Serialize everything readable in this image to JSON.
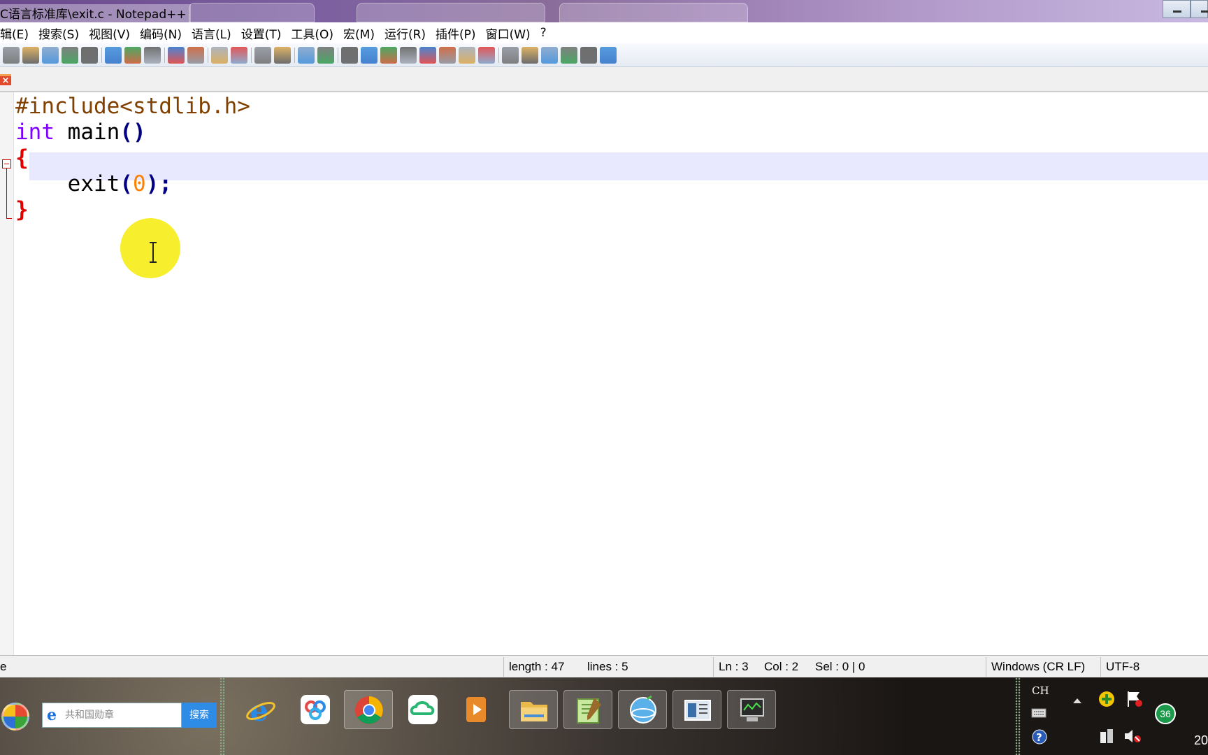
{
  "window": {
    "title": "C语言标准库\\exit.c - Notepad++"
  },
  "menu": {
    "items": [
      "辑(E)",
      "搜索(S)",
      "视图(V)",
      "编码(N)",
      "语言(L)",
      "设置(T)",
      "工具(O)",
      "宏(M)",
      "运行(R)",
      "插件(P)",
      "窗口(W)",
      "?"
    ]
  },
  "toolbar": {
    "buttons": [
      "close-all",
      "new",
      "open",
      "save",
      "print",
      "cut",
      "copy",
      "paste",
      "undo",
      "redo",
      "find",
      "replace",
      "zoom-in",
      "zoom-out",
      "sync-v",
      "sync-h",
      "word-wrap",
      "show-all-chars",
      "indent-guide",
      "user-lang",
      "doc-map",
      "function-list",
      "folder-workspace",
      "monitor",
      "record-macro",
      "stop-macro",
      "play-macro",
      "run-macro-multiple",
      "save-macro",
      "spell-check"
    ]
  },
  "editor": {
    "lines": [
      {
        "tokens": [
          {
            "t": "#include<stdlib.h>",
            "c": "c-pre"
          }
        ]
      },
      {
        "tokens": [
          {
            "t": "int",
            "c": "c-kw"
          },
          {
            "t": " main",
            "c": "c-id"
          },
          {
            "t": "()",
            "c": "c-op"
          }
        ]
      },
      {
        "tokens": [
          {
            "t": "{",
            "c": "c-brace"
          }
        ]
      },
      {
        "tokens": [
          {
            "t": "    exit",
            "c": "c-id"
          },
          {
            "t": "(",
            "c": "c-op"
          },
          {
            "t": "0",
            "c": "c-num"
          },
          {
            "t": ");",
            "c": "c-op"
          }
        ]
      },
      {
        "tokens": [
          {
            "t": "}",
            "c": "c-brace"
          }
        ]
      }
    ],
    "current_line": 3
  },
  "status": {
    "left_fragment": "e",
    "length": "length : 47",
    "lines": "lines : 5",
    "ln": "Ln : 3",
    "col": "Col : 2",
    "sel": "Sel : 0 | 0",
    "eol": "Windows (CR LF)",
    "encoding": "UTF-8"
  },
  "taskbar": {
    "search_placeholder": "共和国勋章",
    "search_button": "搜索",
    "apps": [
      "internet-explorer",
      "baidu-netdisk",
      "chrome",
      "cloud-app",
      "media-player",
      "file-explorer",
      "notepad-plus-plus",
      "browser-app",
      "text-reader",
      "remote-desktop"
    ],
    "tray_lang": "CH",
    "tray_badge": "36",
    "clock_fragment": "20"
  },
  "colors": {
    "preprocessor": "#804000",
    "keyword": "#8000ff",
    "operator": "#000080",
    "number": "#ff8000",
    "brace": "#e00000",
    "current_line": "#e8e8ff"
  }
}
